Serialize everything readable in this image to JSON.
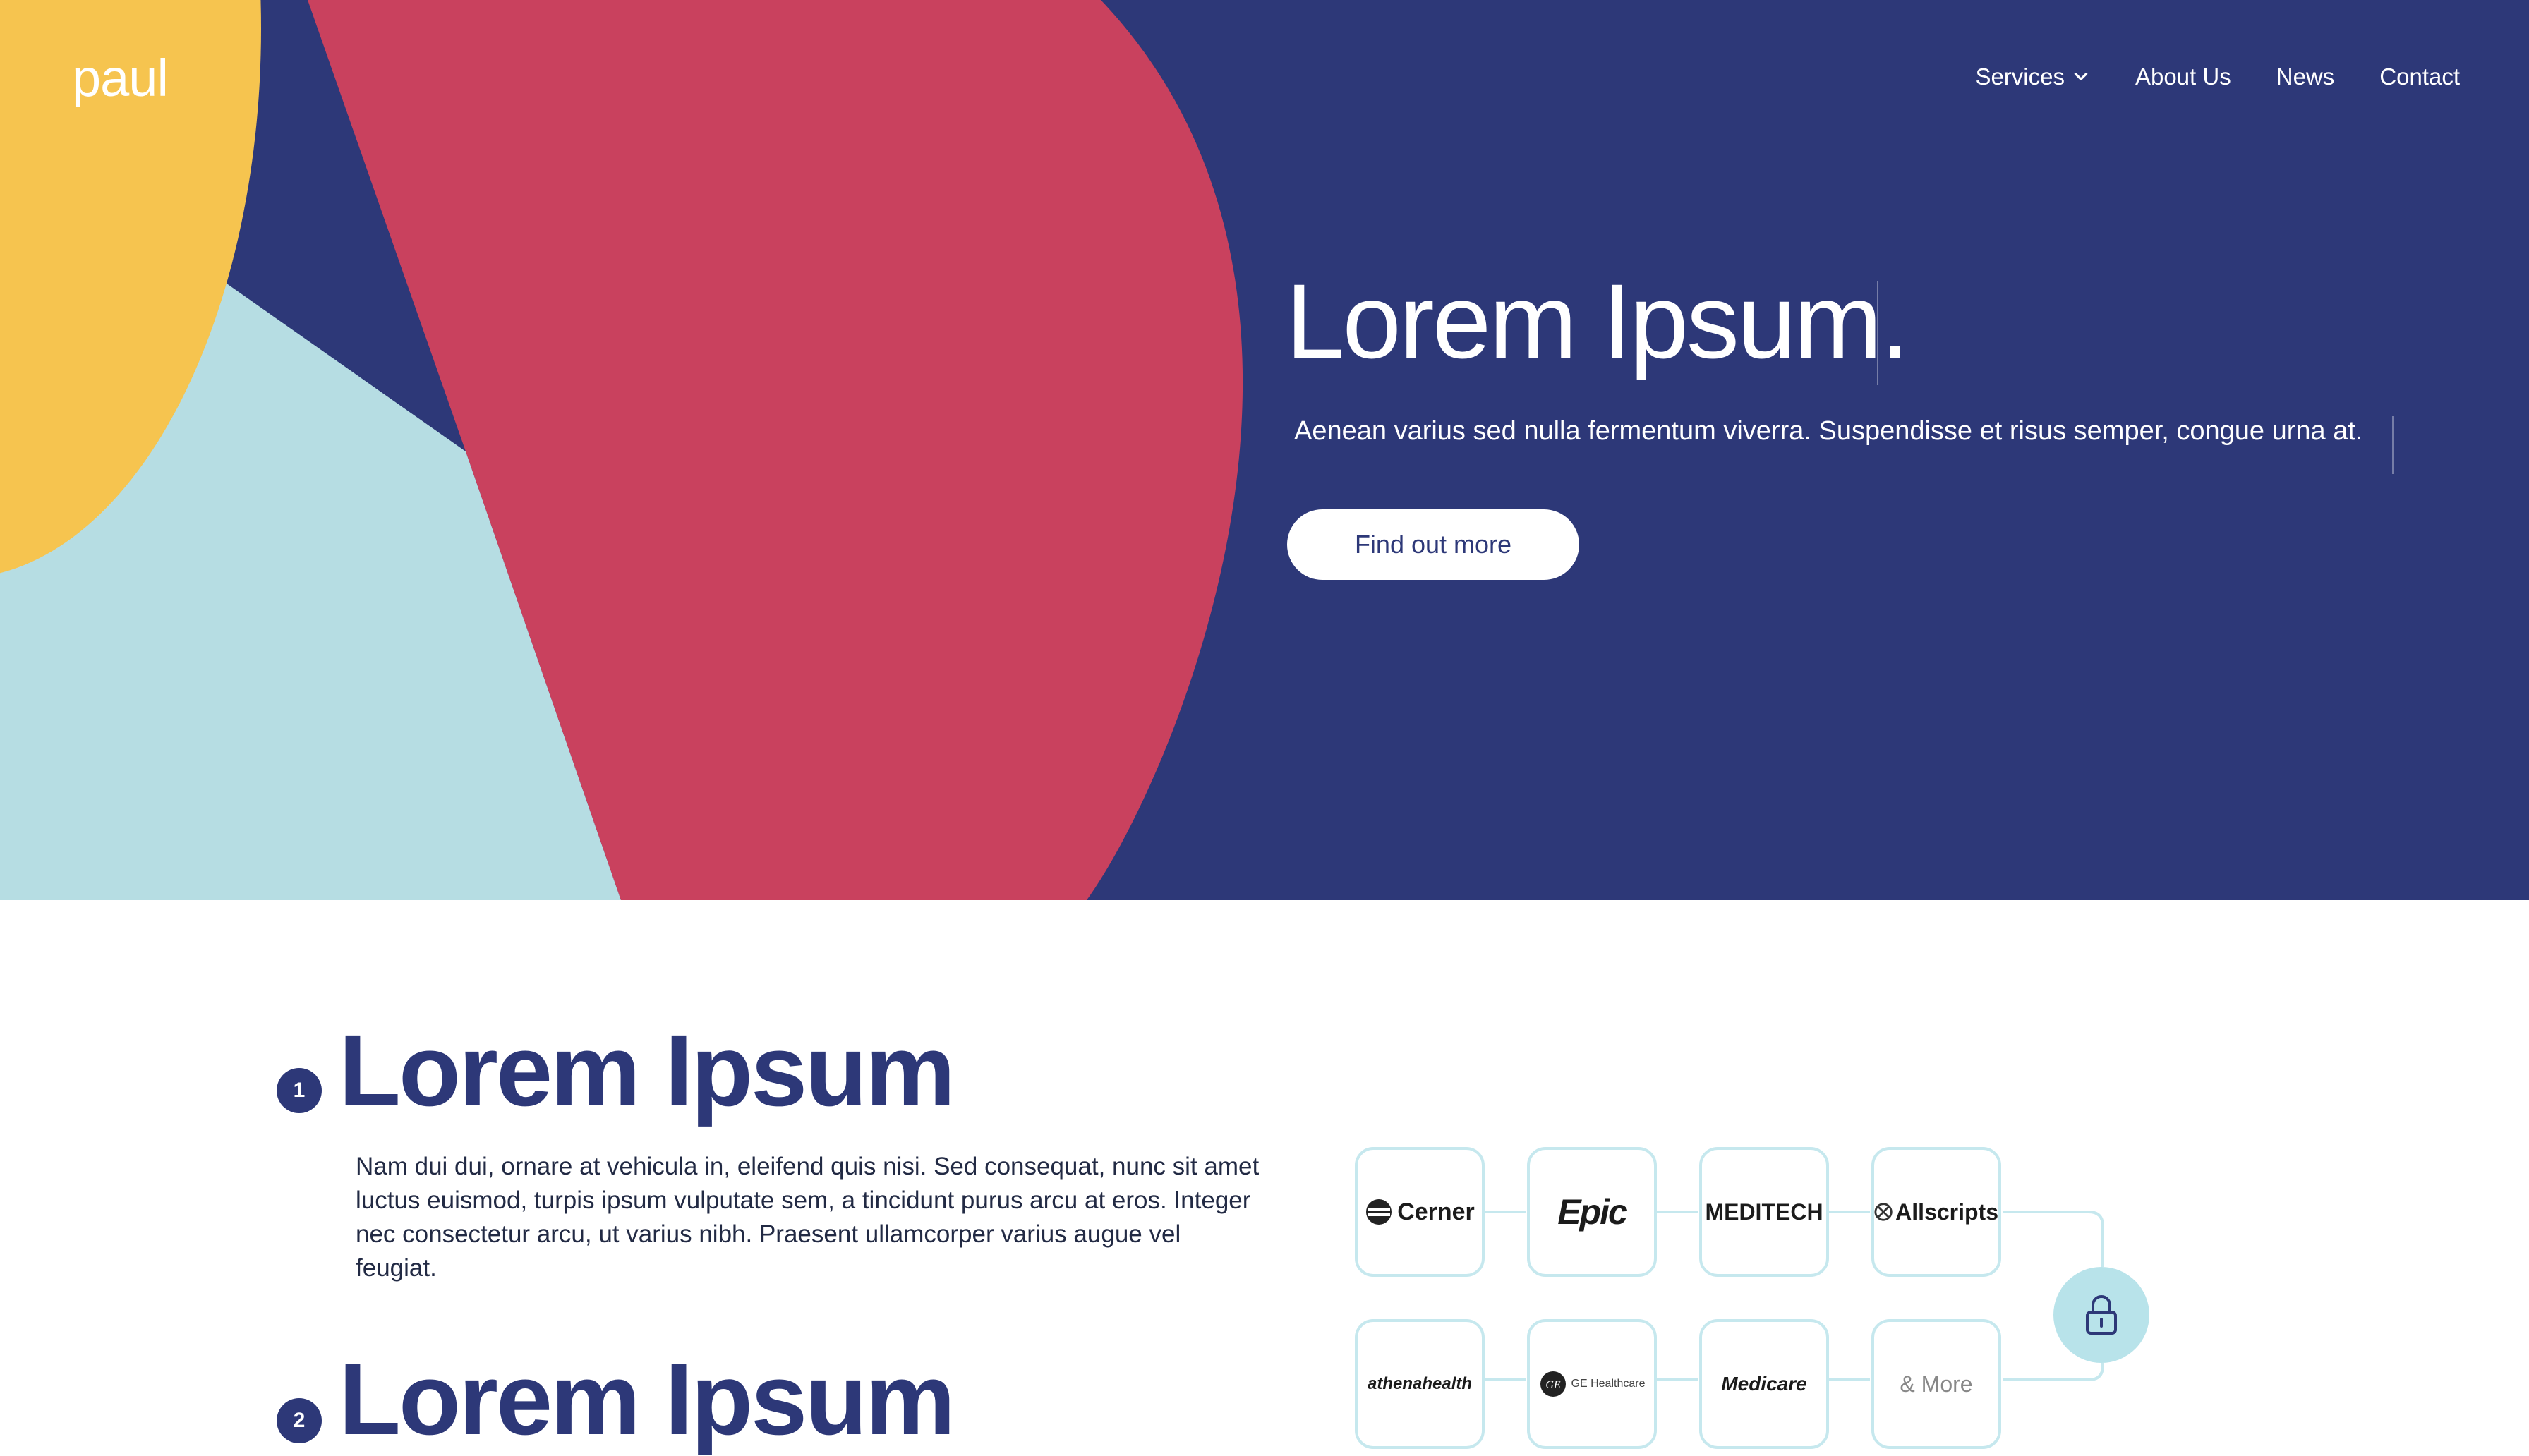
{
  "header": {
    "logo": "paul",
    "nav": [
      {
        "label": "Services",
        "has_dropdown": true
      },
      {
        "label": "About Us"
      },
      {
        "label": "News"
      },
      {
        "label": "Contact"
      }
    ]
  },
  "hero": {
    "title": "Lorem Ipsum.",
    "subtitle": "Aenean varius sed nulla fermentum viverra. Suspendisse et risus semper, congue urna at.",
    "cta": "Find out more",
    "colors": {
      "background": "#2d3878",
      "red": "#c9415e",
      "yellow": "#f6c44f",
      "light_blue": "#b6dde3"
    }
  },
  "steps": [
    {
      "number": "1",
      "title": "Lorem Ipsum",
      "body": "Nam dui dui, ornare at vehicula in, eleifend quis nisi. Sed consequat, nunc sit amet luctus euismod, turpis ipsum vulputate sem, a tincidunt purus arcu at eros. Integer nec consectetur arcu, ut varius nibh. Praesent ullamcorper varius augue vel feugiat."
    },
    {
      "number": "2",
      "title": "Lorem Ipsum"
    }
  ],
  "integrations": [
    {
      "name": "Cerner",
      "icon": "cerner-logo"
    },
    {
      "name": "Epic",
      "icon": "epic-logo"
    },
    {
      "name": "MEDITECH",
      "icon": "meditech-logo"
    },
    {
      "name": "Allscripts",
      "icon": "allscripts-logo"
    },
    {
      "name": "athenahealth",
      "icon": "athenahealth-logo"
    },
    {
      "name": "GE Healthcare",
      "icon": "ge-healthcare-logo"
    },
    {
      "name": "Medicare",
      "icon": "medicare-logo"
    },
    {
      "name": "& More",
      "icon": "more-text"
    }
  ],
  "lock_icon": "lock-icon"
}
